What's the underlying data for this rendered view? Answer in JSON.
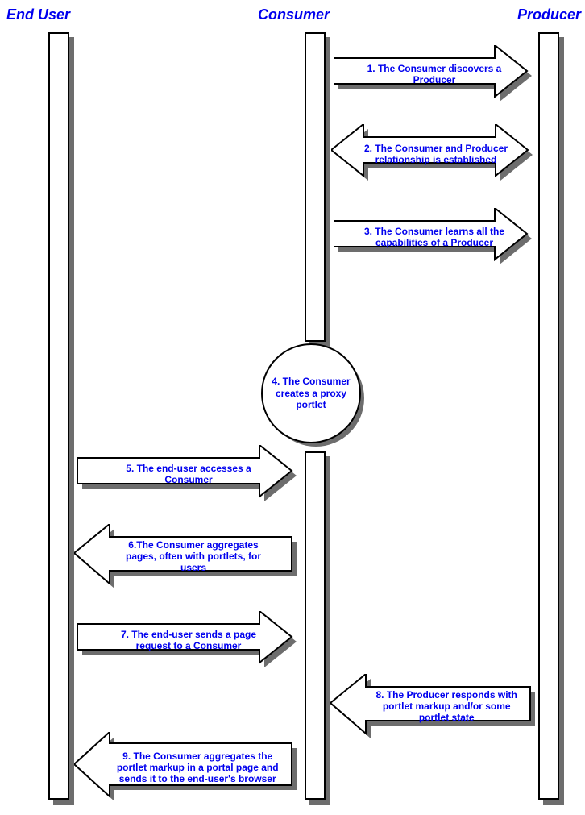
{
  "headers": {
    "endUser": "End User",
    "consumer": "Consumer",
    "producer": "Producer"
  },
  "steps": {
    "s1": "1. The Consumer discovers a Producer",
    "s2": "2. The Consumer and Producer relationship is established",
    "s3": "3. The Consumer learns all the capabilities of a Producer",
    "s4": "4. The Consumer creates a proxy portlet",
    "s5": "5. The end-user accesses a Consumer",
    "s6": "6.The Consumer aggregates pages, often with portlets, for users",
    "s7": "7. The end-user sends a page request to a Consumer",
    "s8": "8. The Producer responds with portlet markup and/or some portlet state",
    "s9": "9. The Consumer aggregates the portlet markup in a portal page and sends it to the end-user's browser"
  }
}
